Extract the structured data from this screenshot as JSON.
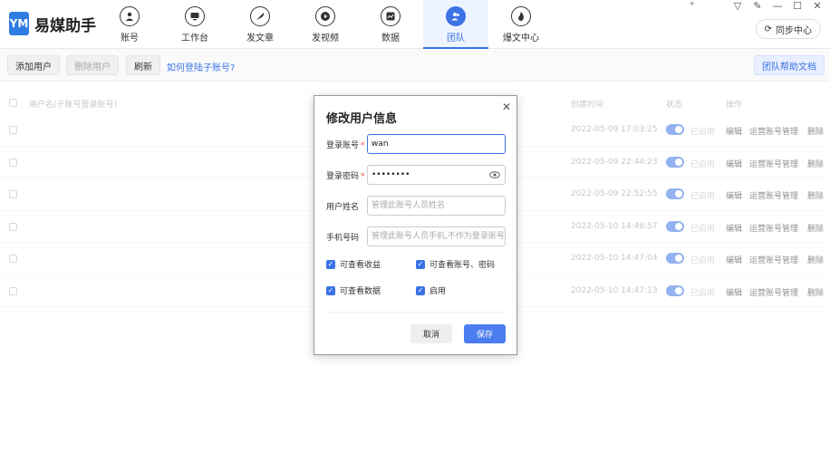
{
  "app": {
    "name": "易媒助手",
    "logo": "YM"
  },
  "nav": [
    {
      "label": "账号",
      "icon": "user-icon"
    },
    {
      "label": "工作台",
      "icon": "monitor-icon"
    },
    {
      "label": "发文章",
      "icon": "feather-icon"
    },
    {
      "label": "发视频",
      "icon": "play-icon"
    },
    {
      "label": "数据",
      "icon": "chart-icon"
    },
    {
      "label": "团队",
      "icon": "team-icon",
      "active": true
    },
    {
      "label": "爆文中心",
      "icon": "flame-icon"
    }
  ],
  "header": {
    "sync_label": "同步中心"
  },
  "toolbar": {
    "add_label": "添加用户",
    "delete_label": "删除用户",
    "refresh_label": "刷新",
    "help_link": "如何登陆子账号?",
    "help_doc": "团队帮助文档"
  },
  "table": {
    "headers": {
      "username": "用户名(子账号登录账号)",
      "created": "创建时间",
      "status": "状态",
      "actions": "操作"
    },
    "rows": [
      {
        "time": "2022-05-09 17:03:25",
        "status": "已启用"
      },
      {
        "time": "2022-05-09 22:44:23",
        "status": "已启用"
      },
      {
        "time": "2022-05-09 22:52:55",
        "status": "已启用"
      },
      {
        "time": "2022-05-10 14:46:57",
        "status": "已启用"
      },
      {
        "time": "2022-05-10 14:47:04",
        "status": "已启用"
      },
      {
        "time": "2022-05-10 14:47:13",
        "status": "已启用"
      }
    ],
    "action_labels": {
      "edit": "编辑",
      "manage": "运营账号管理",
      "delete": "删除"
    }
  },
  "modal": {
    "title": "修改用户信息",
    "account": {
      "label": "登录账号",
      "value": "wan"
    },
    "password": {
      "label": "登录密码",
      "value": "••••••••"
    },
    "name": {
      "label": "用户姓名",
      "placeholder": "管理此账号人员姓名"
    },
    "phone": {
      "label": "手机号码",
      "placeholder": "管理此账号人员手机,不作为登录账号"
    },
    "checks": {
      "income": "可查看收益",
      "account_pwd": "可查看账号、密码",
      "data": "可查看数据",
      "enable": "启用"
    },
    "cancel": "取消",
    "save": "保存"
  }
}
